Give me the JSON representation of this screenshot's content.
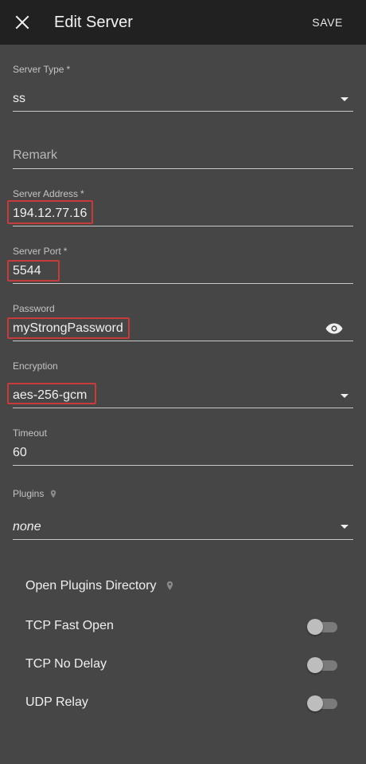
{
  "appbar": {
    "title": "Edit Server",
    "save_label": "SAVE"
  },
  "fields": {
    "server_type": {
      "label": "Server Type",
      "required_mark": "*",
      "value": "ss"
    },
    "remark": {
      "placeholder": "Remark"
    },
    "server_address": {
      "label": "Server Address",
      "required_mark": "*",
      "value": "194.12.77.16"
    },
    "server_port": {
      "label": "Server Port",
      "required_mark": "*",
      "value": "5544"
    },
    "password": {
      "label": "Password",
      "value": "myStrongPassword"
    },
    "encryption": {
      "label": "Encryption",
      "value": "aes-256-gcm"
    },
    "timeout": {
      "label": "Timeout",
      "value": "60"
    },
    "plugins": {
      "label": "Plugins",
      "value": "none"
    }
  },
  "options": {
    "open_plugins_directory": "Open Plugins Directory",
    "tcp_fast_open": {
      "label": "TCP Fast Open",
      "enabled": false
    },
    "tcp_no_delay": {
      "label": "TCP No Delay",
      "enabled": false
    },
    "udp_relay": {
      "label": "UDP Relay",
      "enabled": false
    }
  },
  "colors": {
    "appbar_bg": "#212121",
    "page_bg": "#464646",
    "highlight_border": "#c93a3a"
  },
  "icons": [
    "close-icon",
    "visibility-icon",
    "dropdown-arrow-icon",
    "map-pin-icon"
  ]
}
